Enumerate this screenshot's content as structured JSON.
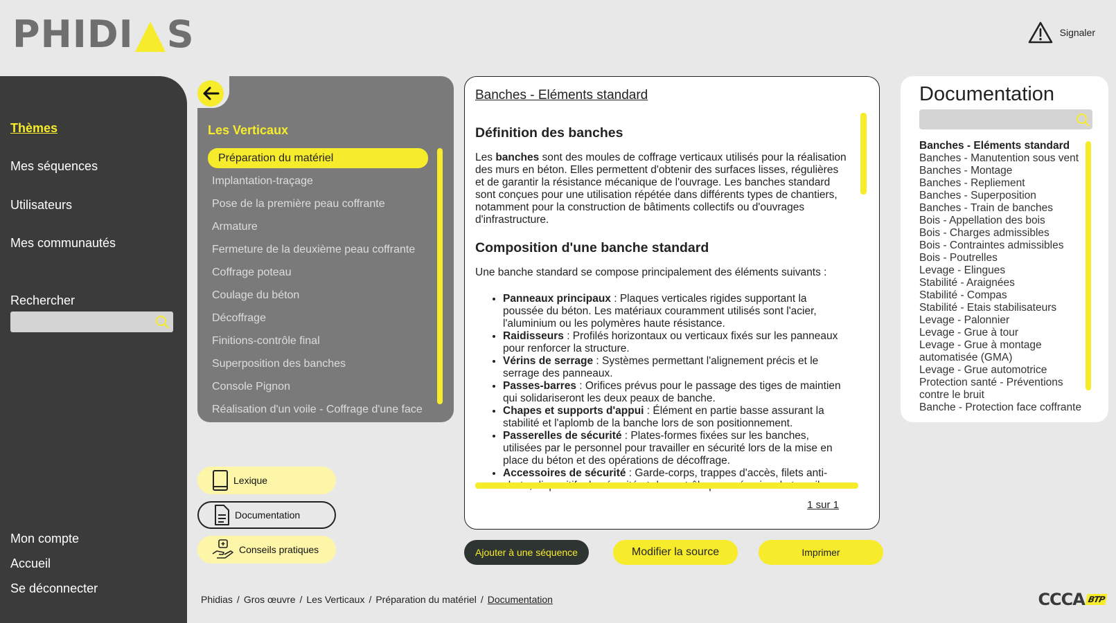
{
  "app": {
    "logo_text": "PHIDIAS",
    "report_label": "Signaler",
    "brand_yellow": "#f7ec2b",
    "sidebar_bg": "#3b3b3b",
    "partner_logo": "CCCA BTP"
  },
  "sidebar": {
    "items": [
      {
        "label": "Thèmes"
      },
      {
        "label": "Mes séquences"
      },
      {
        "label": "Utilisateurs"
      },
      {
        "label": "Mes communautés"
      }
    ],
    "search_label": "Rechercher",
    "bottom_items": [
      {
        "label": "Mon compte"
      },
      {
        "label": "Accueil"
      },
      {
        "label": "Se déconnecter"
      }
    ]
  },
  "themes": {
    "title": "Les Verticaux",
    "items": [
      "Préparation du matériel",
      "Implantation-traçage",
      "Pose de la première peau coffrante",
      "Armature",
      "Fermeture de la deuxième peau coffrante",
      "Coffrage poteau",
      "Coulage du béton",
      "Décoffrage",
      "Finitions-contrôle final",
      "Superposition des banches",
      "Console Pignon",
      "Réalisation d'un voile - Coffrage d'une face"
    ]
  },
  "tools": {
    "lexique": "Lexique",
    "documentation": "Documentation",
    "conseils": "Conseils pratiques"
  },
  "document": {
    "title": "Banches - Eléments standard",
    "h1": "Définition des banches",
    "p1_pre": "Les ",
    "p1_bold": "banches",
    "p1_post": " sont des moules de coffrage verticaux utilisés pour la réalisation des murs en béton. Elles permettent d'obtenir des surfaces lisses, régulières et de garantir la résistance mécanique de l'ouvrage. Les banches standard sont conçues pour une utilisation répétée dans différents types de chantiers, notamment pour la construction de bâtiments collectifs ou d'ouvrages d'infrastructure.",
    "h2": "Composition d'une banche standard",
    "p2": "Une banche standard se compose principalement des éléments suivants :",
    "list": [
      {
        "term": "Panneaux principaux",
        "desc": " : Plaques verticales rigides supportant la poussée du béton. Les matériaux couramment utilisés sont l'acier, l'aluminium ou les polymères haute résistance."
      },
      {
        "term": "Raidisseurs",
        "desc": " : Profilés horizontaux ou verticaux fixés sur les panneaux pour renforcer la structure."
      },
      {
        "term": "Vérins de serrage",
        "desc": " : Systèmes permettant l'alignement précis et le serrage des panneaux."
      },
      {
        "term": "Passes-barres",
        "desc": " : Orifices prévus pour le passage des tiges de maintien qui solidariseront les deux peaux de banche."
      },
      {
        "term": "Chapes et supports d'appui",
        "desc": " : Élément en partie basse assurant la stabilité et l'aplomb de la banche lors de son positionnement."
      },
      {
        "term": "Passerelles de sécurité",
        "desc": " : Plates-formes fixées sur les banches, utilisées par le personnel pour travailler en sécurité lors de la mise en place du béton et des opérations de décoffrage."
      },
      {
        "term": "Accessoires de sécurité",
        "desc": " : Garde-corps, trappes d'accès, filets anti-chute, dispositifs de sécurité et de contrôle pour sécuriser le travail."
      }
    ],
    "pagination": "1 sur 1"
  },
  "actions": {
    "add_to_sequence": "Ajouter à une séquence",
    "edit_source": "Modifier la source",
    "print": "Imprimer"
  },
  "docs": {
    "title": "Documentation",
    "items": [
      "Banches - Eléments standard",
      "Banches - Manutention sous vent",
      "Banches - Montage",
      "Banches - Repliement",
      "Banches - Superposition",
      "Banches - Train de banches",
      "Bois - Appellation des bois",
      "Bois - Charges admissibles",
      "Bois - Contraintes admissibles",
      "Bois - Poutrelles",
      "Levage - Elingues",
      "Stabilité - Araignées",
      "Stabilité - Compas",
      "Stabilité - Etais stabilisateurs",
      "Levage - Palonnier",
      "Levage - Grue à tour",
      "Levage - Grue à montage automatisée (GMA)",
      "Levage - Grue automotrice",
      "Protection santé - Préventions contre le bruit",
      "Banche - Protection face coffrante"
    ]
  },
  "breadcrumb": [
    "Phidias",
    "Gros œuvre",
    "Les Verticaux",
    "Préparation du matériel",
    "Documentation"
  ]
}
